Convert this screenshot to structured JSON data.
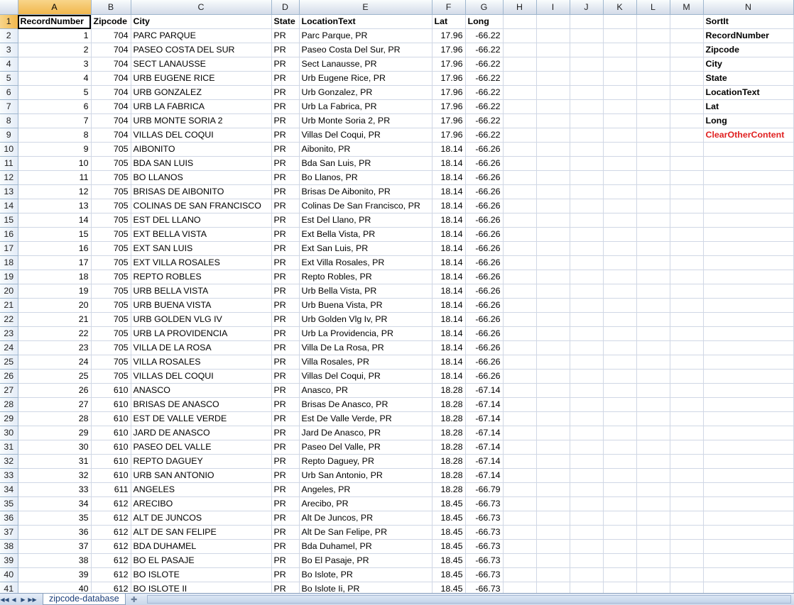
{
  "sheet_tab": "zipcode-database",
  "columns": [
    "A",
    "B",
    "C",
    "D",
    "E",
    "F",
    "G",
    "H",
    "I",
    "J",
    "K",
    "L",
    "M",
    "N"
  ],
  "header_row": [
    "RecordNumber",
    "Zipcode",
    "City",
    "State",
    "LocationText",
    "Lat",
    "Long"
  ],
  "side_list": [
    {
      "text": "SortIt",
      "style": "bold"
    },
    {
      "text": "RecordNumber",
      "style": "bold"
    },
    {
      "text": "Zipcode",
      "style": "bold"
    },
    {
      "text": "City",
      "style": "bold"
    },
    {
      "text": "State",
      "style": "bold"
    },
    {
      "text": "LocationText",
      "style": "bold"
    },
    {
      "text": "Lat",
      "style": "bold"
    },
    {
      "text": "Long",
      "style": "bold"
    },
    {
      "text": "ClearOtherContent",
      "style": "red"
    }
  ],
  "rows": [
    [
      "1",
      "704",
      "PARC PARQUE",
      "PR",
      "Parc Parque, PR",
      "17.96",
      "-66.22"
    ],
    [
      "2",
      "704",
      "PASEO COSTA DEL SUR",
      "PR",
      "Paseo Costa Del Sur, PR",
      "17.96",
      "-66.22"
    ],
    [
      "3",
      "704",
      "SECT LANAUSSE",
      "PR",
      "Sect Lanausse, PR",
      "17.96",
      "-66.22"
    ],
    [
      "4",
      "704",
      "URB EUGENE RICE",
      "PR",
      "Urb Eugene Rice, PR",
      "17.96",
      "-66.22"
    ],
    [
      "5",
      "704",
      "URB GONZALEZ",
      "PR",
      "Urb Gonzalez, PR",
      "17.96",
      "-66.22"
    ],
    [
      "6",
      "704",
      "URB LA FABRICA",
      "PR",
      "Urb La Fabrica, PR",
      "17.96",
      "-66.22"
    ],
    [
      "7",
      "704",
      "URB MONTE SORIA 2",
      "PR",
      "Urb Monte Soria 2, PR",
      "17.96",
      "-66.22"
    ],
    [
      "8",
      "704",
      "VILLAS DEL COQUI",
      "PR",
      "Villas Del Coqui, PR",
      "17.96",
      "-66.22"
    ],
    [
      "9",
      "705",
      "AIBONITO",
      "PR",
      "Aibonito, PR",
      "18.14",
      "-66.26"
    ],
    [
      "10",
      "705",
      "BDA SAN LUIS",
      "PR",
      "Bda San Luis, PR",
      "18.14",
      "-66.26"
    ],
    [
      "11",
      "705",
      "BO LLANOS",
      "PR",
      "Bo Llanos, PR",
      "18.14",
      "-66.26"
    ],
    [
      "12",
      "705",
      "BRISAS DE AIBONITO",
      "PR",
      "Brisas De Aibonito, PR",
      "18.14",
      "-66.26"
    ],
    [
      "13",
      "705",
      "COLINAS DE SAN FRANCISCO",
      "PR",
      "Colinas De San Francisco, PR",
      "18.14",
      "-66.26"
    ],
    [
      "14",
      "705",
      "EST DEL LLANO",
      "PR",
      "Est Del Llano, PR",
      "18.14",
      "-66.26"
    ],
    [
      "15",
      "705",
      "EXT BELLA VISTA",
      "PR",
      "Ext Bella Vista, PR",
      "18.14",
      "-66.26"
    ],
    [
      "16",
      "705",
      "EXT SAN LUIS",
      "PR",
      "Ext San Luis, PR",
      "18.14",
      "-66.26"
    ],
    [
      "17",
      "705",
      "EXT VILLA ROSALES",
      "PR",
      "Ext Villa Rosales, PR",
      "18.14",
      "-66.26"
    ],
    [
      "18",
      "705",
      "REPTO ROBLES",
      "PR",
      "Repto Robles, PR",
      "18.14",
      "-66.26"
    ],
    [
      "19",
      "705",
      "URB BELLA VISTA",
      "PR",
      "Urb Bella Vista, PR",
      "18.14",
      "-66.26"
    ],
    [
      "20",
      "705",
      "URB BUENA VISTA",
      "PR",
      "Urb Buena Vista, PR",
      "18.14",
      "-66.26"
    ],
    [
      "21",
      "705",
      "URB GOLDEN VLG IV",
      "PR",
      "Urb Golden Vlg Iv, PR",
      "18.14",
      "-66.26"
    ],
    [
      "22",
      "705",
      "URB LA PROVIDENCIA",
      "PR",
      "Urb La Providencia, PR",
      "18.14",
      "-66.26"
    ],
    [
      "23",
      "705",
      "VILLA DE LA ROSA",
      "PR",
      "Villa De La Rosa, PR",
      "18.14",
      "-66.26"
    ],
    [
      "24",
      "705",
      "VILLA ROSALES",
      "PR",
      "Villa Rosales, PR",
      "18.14",
      "-66.26"
    ],
    [
      "25",
      "705",
      "VILLAS DEL COQUI",
      "PR",
      "Villas Del Coqui, PR",
      "18.14",
      "-66.26"
    ],
    [
      "26",
      "610",
      "ANASCO",
      "PR",
      "Anasco, PR",
      "18.28",
      "-67.14"
    ],
    [
      "27",
      "610",
      "BRISAS DE ANASCO",
      "PR",
      "Brisas De Anasco, PR",
      "18.28",
      "-67.14"
    ],
    [
      "28",
      "610",
      "EST DE VALLE VERDE",
      "PR",
      "Est De Valle Verde, PR",
      "18.28",
      "-67.14"
    ],
    [
      "29",
      "610",
      "JARD DE ANASCO",
      "PR",
      "Jard De Anasco, PR",
      "18.28",
      "-67.14"
    ],
    [
      "30",
      "610",
      "PASEO DEL VALLE",
      "PR",
      "Paseo Del Valle, PR",
      "18.28",
      "-67.14"
    ],
    [
      "31",
      "610",
      "REPTO DAGUEY",
      "PR",
      "Repto Daguey, PR",
      "18.28",
      "-67.14"
    ],
    [
      "32",
      "610",
      "URB SAN ANTONIO",
      "PR",
      "Urb San Antonio, PR",
      "18.28",
      "-67.14"
    ],
    [
      "33",
      "611",
      "ANGELES",
      "PR",
      "Angeles, PR",
      "18.28",
      "-66.79"
    ],
    [
      "34",
      "612",
      "ARECIBO",
      "PR",
      "Arecibo, PR",
      "18.45",
      "-66.73"
    ],
    [
      "35",
      "612",
      "ALT DE JUNCOS",
      "PR",
      "Alt De Juncos, PR",
      "18.45",
      "-66.73"
    ],
    [
      "36",
      "612",
      "ALT DE SAN FELIPE",
      "PR",
      "Alt De San Felipe, PR",
      "18.45",
      "-66.73"
    ],
    [
      "37",
      "612",
      "BDA DUHAMEL",
      "PR",
      "Bda Duhamel, PR",
      "18.45",
      "-66.73"
    ],
    [
      "38",
      "612",
      "BO EL PASAJE",
      "PR",
      "Bo El Pasaje, PR",
      "18.45",
      "-66.73"
    ],
    [
      "39",
      "612",
      "BO ISLOTE",
      "PR",
      "Bo Islote, PR",
      "18.45",
      "-66.73"
    ],
    [
      "40",
      "612",
      "BO ISLOTE II",
      "PR",
      "Bo Islote Ii, PR",
      "18.45",
      "-66.73"
    ]
  ]
}
